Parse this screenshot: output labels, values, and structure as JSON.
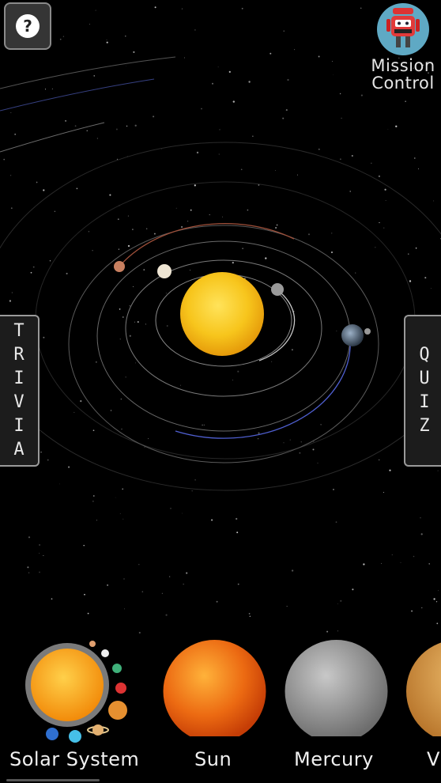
{
  "help": {
    "glyph": "?",
    "icon": "question-icon"
  },
  "mission_control": {
    "label_line1": "Mission",
    "label_line2": "Control",
    "icon": "robot-icon"
  },
  "trivia_tab": {
    "letters": [
      "T",
      "R",
      "I",
      "V",
      "I",
      "A"
    ]
  },
  "quiz_tab": {
    "letters": [
      "Q",
      "U",
      "I",
      "Z"
    ]
  },
  "carousel": {
    "items": [
      {
        "label": "Solar System",
        "icon": "solar-system-icon"
      },
      {
        "label": "Sun",
        "icon": "sun-icon"
      },
      {
        "label": "Mercury",
        "icon": "mercury-icon"
      },
      {
        "label": "V",
        "icon": "venus-icon"
      }
    ]
  },
  "colors": {
    "background": "#000000",
    "sun": "#f7c51c",
    "panel": "#1c1c1c",
    "border": "#9a9a9a"
  }
}
